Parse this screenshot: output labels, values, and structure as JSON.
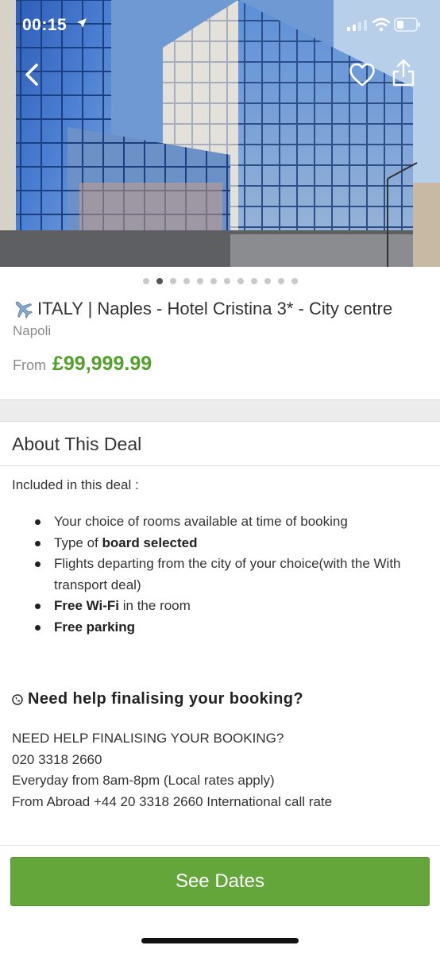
{
  "status_bar": {
    "time": "00:15"
  },
  "icons": {
    "back": "chevron-left-icon",
    "favorite": "heart-icon",
    "share": "share-icon",
    "title_prefix": "airplane-icon",
    "help": "phone-icon"
  },
  "gallery": {
    "dot_count": 12,
    "active_index": 1
  },
  "deal": {
    "title": "ITALY | Naples - Hotel Cristina 3* - City centre",
    "city": "Napoli",
    "price_label": "From",
    "price": "£99,999.99"
  },
  "about": {
    "heading": "About This Deal",
    "intro": "Included in this deal :",
    "features": [
      {
        "pre": "Your choice of rooms available at time of booking",
        "bold": "",
        "post": ""
      },
      {
        "pre": "Type of ",
        "bold": "board selected",
        "post": ""
      },
      {
        "pre": "Flights departing from the city of your choice(with the With transport deal)",
        "bold": "",
        "post": ""
      },
      {
        "pre": "",
        "bold": "Free Wi-Fi",
        "post": " in the room"
      },
      {
        "pre": "",
        "bold": "Free parking",
        "post": ""
      }
    ]
  },
  "help": {
    "heading": "Need help finalising your booking?",
    "lines": [
      "NEED HELP FINALISING YOUR BOOKING?",
      "020 3318 2660",
      "Everyday from 8am-8pm (Local rates apply)",
      "From Abroad +44 20 3318 2660 International call rate"
    ]
  },
  "cta": {
    "label": "See Dates"
  },
  "colors": {
    "accent_green": "#64a63a",
    "price_green": "#53a02a"
  }
}
